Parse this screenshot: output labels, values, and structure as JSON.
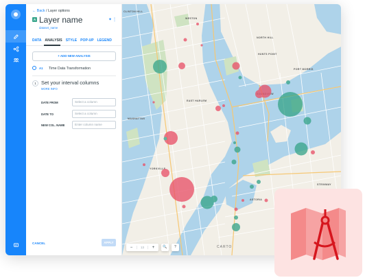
{
  "nav": {
    "back_label": "Back",
    "crumb": "/ Layer options"
  },
  "layer": {
    "badge": "A",
    "title": "Layer name",
    "subtitle": "dataset_name"
  },
  "tabs": [
    "DATA",
    "ANALYSIS",
    "STYLE",
    "POP-UP",
    "LEGEND"
  ],
  "active_tab": "ANALYSIS",
  "add_analysis_label": "+ ADD NEW ANALYSIS",
  "analysis": {
    "id": "A1",
    "name": "Time Data Transformation"
  },
  "step": {
    "number": "1",
    "title": "Set your interval columns",
    "more_info": "MORE INFO",
    "fields": [
      {
        "label": "DATE FROM",
        "placeholder": "Select a column"
      },
      {
        "label": "DATE TO",
        "placeholder": "Select a column"
      },
      {
        "label": "NEW COL. NAME",
        "placeholder": "Enter column name"
      }
    ]
  },
  "footer": {
    "cancel": "CANCEL",
    "apply": "APPLY"
  },
  "map": {
    "zoom_level": "13",
    "zoom_in": "+",
    "zoom_out": "−",
    "search": "🔍",
    "help": "?",
    "attribution": "CARTO",
    "labels": [
      "CLINTON HILL",
      "NORTH HILL",
      "WESTON",
      "MANHATTAN",
      "EAST HARLEM",
      "YORKVILLE",
      "HUNTS POINT",
      "PORT MORRIS",
      "ASTORIA",
      "STEINWAY",
      "SOUNDVIEW",
      "NORTH SIDE"
    ],
    "colors": {
      "red": "#e8536a",
      "green": "#3aa68c"
    }
  }
}
